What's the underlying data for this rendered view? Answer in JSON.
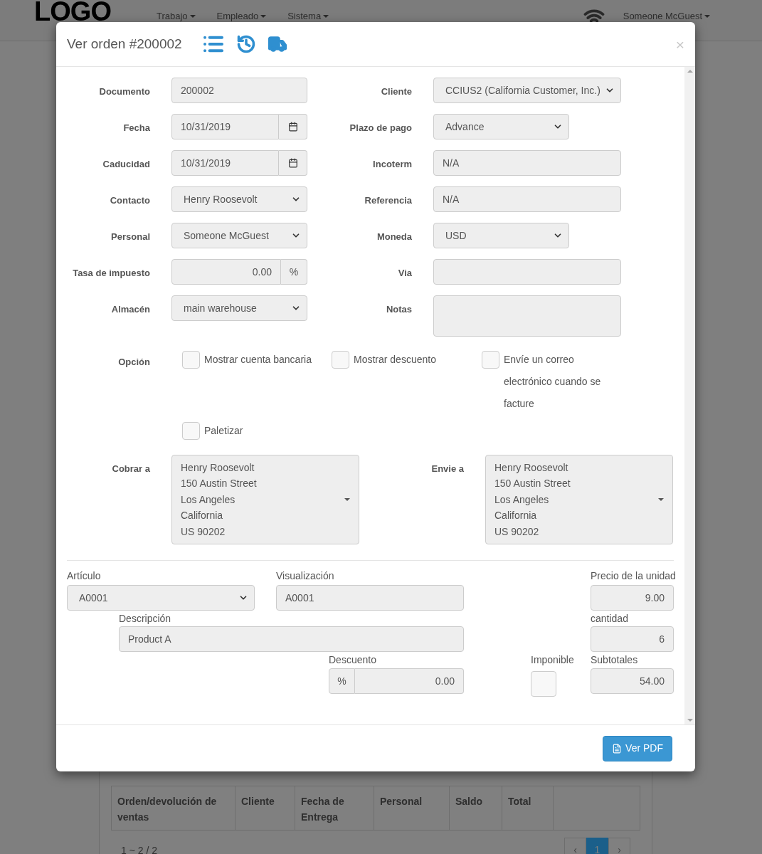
{
  "navbar": {
    "logo": "LOGO",
    "menus": [
      "Trabajo",
      "Empleado",
      "Sistema"
    ],
    "user": "Someone McGuest"
  },
  "background": {
    "columns": [
      "Orden/devolución de ventas",
      "Cliente",
      "Fecha de Entrega",
      "Personal",
      "Saldo",
      "Total"
    ],
    "count": "1 ~ 2 / 2",
    "pagination": [
      {
        "label": "‹",
        "selected": false
      },
      {
        "label": "1",
        "selected": true
      },
      {
        "label": "›",
        "selected": false
      }
    ]
  },
  "modal": {
    "title": "Ver orden #200002",
    "close": "×",
    "rows": [
      {
        "left": {
          "label": "Documento",
          "kind": "input",
          "value": "200002"
        },
        "right": {
          "label": "Cliente",
          "kind": "select",
          "value": "CCIUS2 (California Customer, Inc.)",
          "wide": true
        }
      },
      {
        "left": {
          "label": "Fecha",
          "kind": "date",
          "value": "10/31/2019"
        },
        "right": {
          "label": "Plazo de pago",
          "kind": "select",
          "value": "Advance",
          "wide": false
        }
      },
      {
        "left": {
          "label": "Caducidad",
          "kind": "date",
          "value": "10/31/2019"
        },
        "right": {
          "label": "Incoterm",
          "kind": "input",
          "value": "N/A",
          "wide": true
        }
      },
      {
        "left": {
          "label": "Contacto",
          "kind": "select",
          "value": "Henry Roosevolt"
        },
        "right": {
          "label": "Referencia",
          "kind": "input",
          "value": "N/A",
          "wide": true
        }
      },
      {
        "left": {
          "label": "Personal",
          "kind": "select",
          "value": "Someone McGuest"
        },
        "right": {
          "label": "Moneda",
          "kind": "select",
          "value": "USD",
          "wide": false
        }
      },
      {
        "left": {
          "label": "Tasa de impuesto",
          "kind": "percent",
          "value": "0.00",
          "addon": "%"
        },
        "right": {
          "label": "Via",
          "kind": "input",
          "wide": true
        }
      },
      {
        "left": {
          "label": "Almacén",
          "kind": "select",
          "value": "main warehouse"
        },
        "right": {
          "label": "Notas",
          "kind": "textarea",
          "wide": true
        }
      }
    ],
    "options": {
      "label": "Opción",
      "items": [
        {
          "label": "Mostrar cuenta bancaria",
          "checked": false
        },
        {
          "label": "Mostrar descuento",
          "checked": false
        },
        {
          "label": "Envíe un correo electrónico cuando se facture",
          "checked": false
        },
        {
          "label": "Paletizar",
          "checked": false
        }
      ]
    },
    "addresses": [
      {
        "label": "Cobrar a",
        "lines": [
          "Henry Roosevolt",
          "150 Austin Street",
          "Los Angeles",
          "California",
          "US 90202"
        ]
      },
      {
        "label": "Envie a",
        "lines": [
          "Henry Roosevolt",
          "150 Austin Street",
          "Los Angeles",
          "California",
          "US 90202"
        ]
      }
    ],
    "item": {
      "article_label": "Artículo",
      "article": "A0001",
      "display_label": "Visualización",
      "display": "A0001",
      "price_label": "Precio de la unidad",
      "price": "9.00",
      "description_label": "Descripción",
      "description": "Product A",
      "quantity_label": "cantidad",
      "quantity": "6",
      "discount_label": "Descuento",
      "discount_addon": "%",
      "discount": "0.00",
      "taxable_label": "Imponible",
      "taxable": false,
      "subtotal_label": "Subtotales",
      "subtotal": "54.00"
    },
    "footer_button": "Ver PDF"
  }
}
